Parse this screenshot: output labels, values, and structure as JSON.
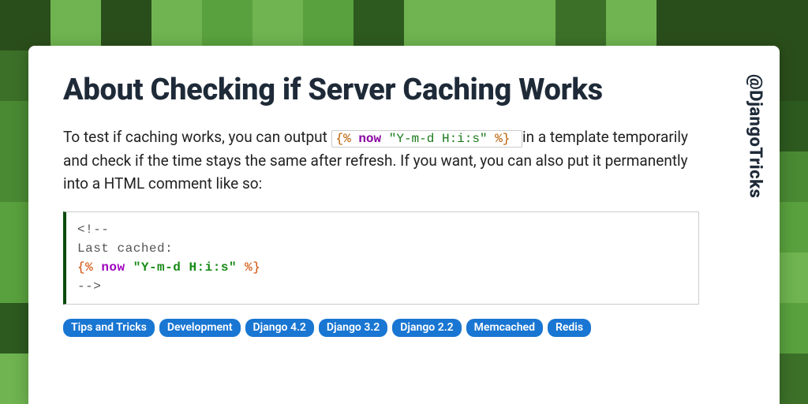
{
  "title": "About Checking if Server Caching Works",
  "handle": "@DjangoTricks",
  "body": {
    "pre": "To test if caching works, you can output ",
    "inline_code": {
      "open": "{%",
      "keyword": "now",
      "string": "\"Y-m-d H:i:s\"",
      "close": "%}"
    },
    "post": " in a template temporarily and check if the time stays the same after refresh. If you want, you can also put it permanently into a HTML comment like so:"
  },
  "code_block": {
    "line1": "<!--",
    "line2": "Last cached:",
    "tag_open": "{%",
    "tag_keyword": "now",
    "tag_string": "\"Y-m-d H:i:s\"",
    "tag_close": "%}",
    "line4": "-->"
  },
  "tags": [
    "Tips and Tricks",
    "Development",
    "Django 4.2",
    "Django 3.2",
    "Django 2.2",
    "Memcached",
    "Redis"
  ],
  "bg_palette": [
    "#2d5a1f",
    "#3c7028",
    "#4a8a33",
    "#59a13e",
    "#6fb450",
    "#2a4e1b"
  ]
}
